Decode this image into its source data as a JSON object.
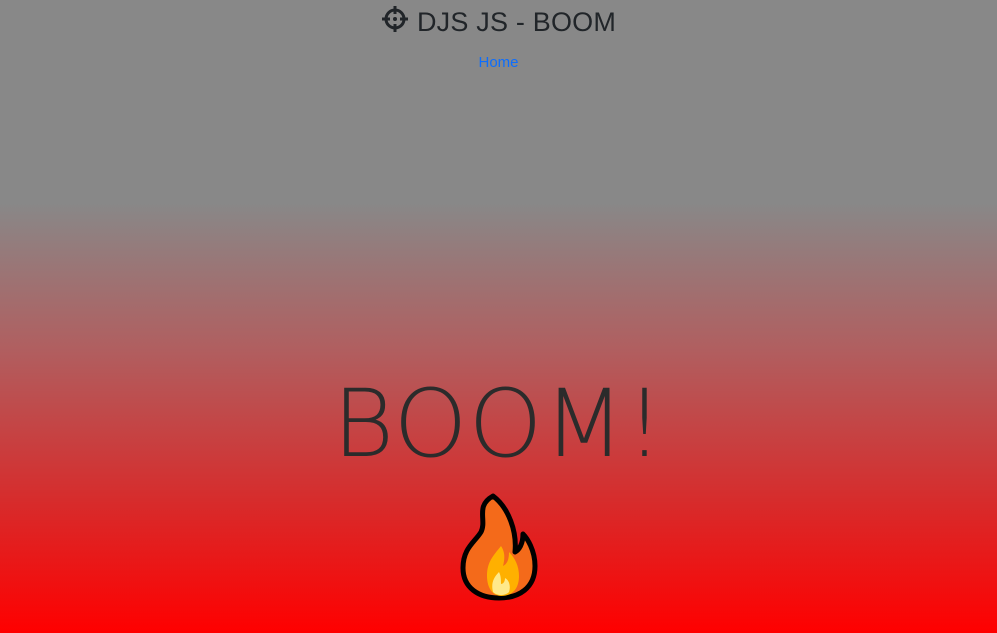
{
  "header": {
    "title": "DJS JS - BOOM",
    "icon": "crosshair-icon"
  },
  "nav": {
    "home_label": "Home"
  },
  "hero": {
    "text": "BOOM!",
    "emoji_icon": "fire-icon"
  },
  "colors": {
    "gradient_top": "#888888",
    "gradient_bottom": "#ff0000",
    "link": "#0d6efd",
    "text": "#212529"
  }
}
